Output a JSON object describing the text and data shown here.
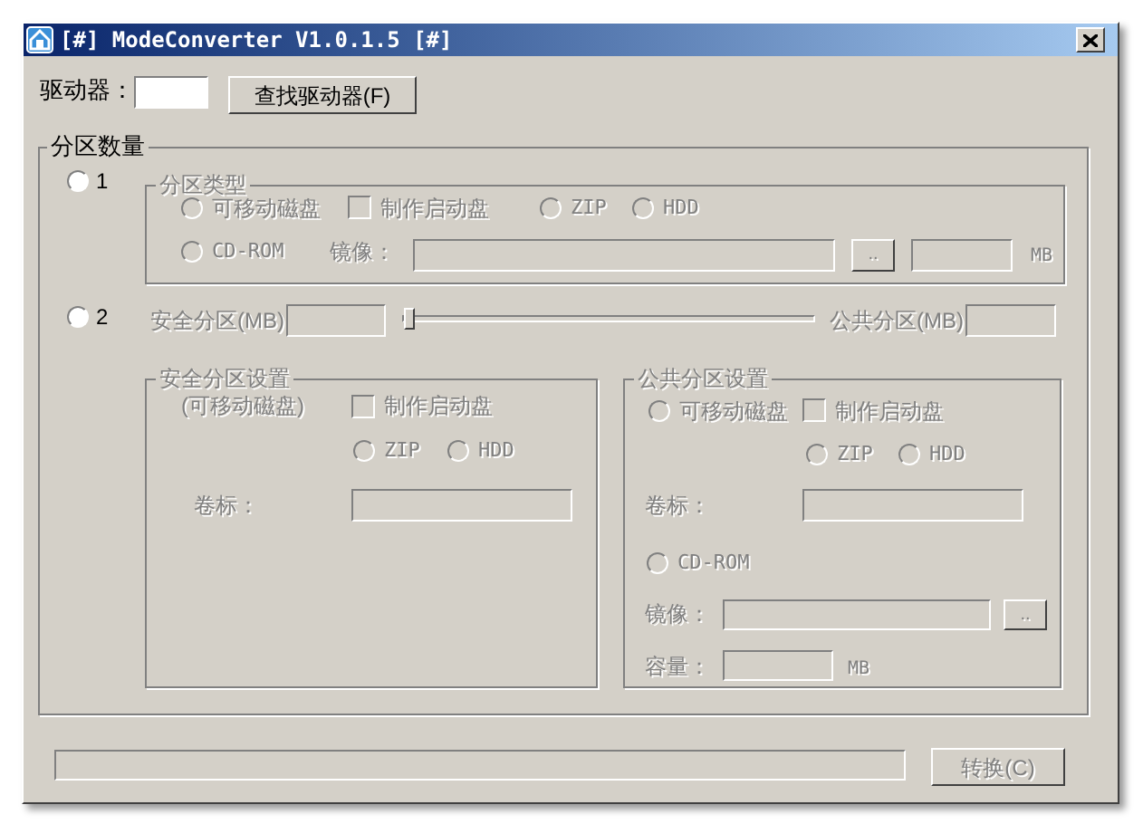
{
  "window": {
    "title": "[#] ModeConverter V1.0.1.5 [#]"
  },
  "drive": {
    "label": "驱动器：",
    "find_button": "查找驱动器(F)"
  },
  "partition_count": {
    "title": "分区数量",
    "options": [
      {
        "label": "1",
        "selected": false
      },
      {
        "label": "2",
        "selected": false
      }
    ]
  },
  "partition_type": {
    "title": "分区类型",
    "disabled": true,
    "types": [
      {
        "label": "可移动磁盘",
        "selected": false
      },
      {
        "label": "ZIP",
        "selected": false
      },
      {
        "label": "HDD",
        "selected": false
      },
      {
        "label": "CD-ROM",
        "selected": false
      }
    ],
    "boot_disk": {
      "label": "制作启动盘",
      "checked": false
    },
    "image_label": "镜像：",
    "browse_button": "..",
    "size_unit": "MB"
  },
  "split": {
    "disabled": true,
    "secure_label": "安全分区(MB)",
    "public_label": "公共分区(MB)",
    "level": 0
  },
  "secure_settings": {
    "title": "安全分区设置",
    "disabled": true,
    "note": "(可移动磁盘)",
    "boot_disk": {
      "label": "制作启动盘",
      "checked": false
    },
    "types": [
      {
        "label": "ZIP",
        "selected": false
      },
      {
        "label": "HDD",
        "selected": false
      }
    ],
    "volume_label": "卷标："
  },
  "public_settings": {
    "title": "公共分区设置",
    "disabled": true,
    "types": [
      {
        "label": "可移动磁盘",
        "selected": false
      },
      {
        "label": "ZIP",
        "selected": false
      },
      {
        "label": "HDD",
        "selected": false
      },
      {
        "label": "CD-ROM",
        "selected": false
      }
    ],
    "boot_disk": {
      "label": "制作启动盘",
      "checked": false
    },
    "volume_label": "卷标：",
    "image_label": "镜像：",
    "browse_button": "..",
    "capacity_label": "容量：",
    "capacity_unit": "MB"
  },
  "convert_button": {
    "label": "转换(C)",
    "disabled": true
  }
}
